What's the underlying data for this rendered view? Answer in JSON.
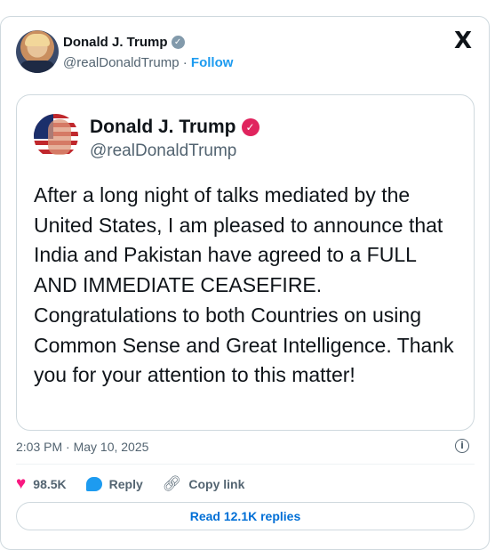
{
  "top_strip": {
    "text": "· ·· ·  ·   · · ··   ·   · ·"
  },
  "header": {
    "name": "Donald J. Trump",
    "handle": "@realDonaldTrump",
    "separator": "·",
    "follow_label": "Follow",
    "platform_logo": "X"
  },
  "embedded_post": {
    "name": "Donald J. Trump",
    "handle": "@realDonaldTrump",
    "text": "After a long night of talks mediated by the United States, I am pleased to announce that India and Pakistan have agreed to a FULL AND IMMEDIATE CEASEFIRE. Congratulations to both Countries on using Common Sense and Great Intelligence. Thank you for your attention to this matter!"
  },
  "meta": {
    "timestamp": "2:03 PM · May 10, 2025",
    "info_icon": "i"
  },
  "actions": {
    "likes": "98.5K",
    "reply_label": "Reply",
    "copy_link_label": "Copy link"
  },
  "footer": {
    "replies_label": "Read 12.1K replies"
  },
  "icons": {
    "verified_header": "gray-verified-badge",
    "verified_embed": "pink-verified-badge",
    "heart": "heart-icon",
    "reply": "reply-bubble-icon",
    "link": "link-icon",
    "info": "info-icon"
  },
  "colors": {
    "accent": "#1d9bf0",
    "like": "#f91880",
    "muted": "#536471",
    "border": "#cfd9de",
    "link_text": "#006fd6"
  }
}
